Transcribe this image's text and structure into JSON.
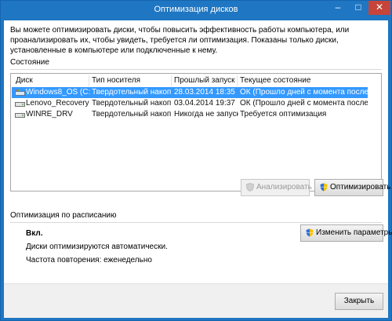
{
  "window": {
    "title": "Оптимизация дисков",
    "controls": {
      "minimize": "–",
      "maximize": "□",
      "close": "✕"
    }
  },
  "intro_text": "Вы можете оптимизировать диски, чтобы повысить эффективность работы  компьютера, или проанализировать их, чтобы увидеть, требуется ли оптимизация. Показаны только диски, установленные в компьютере или подключенные к нему.",
  "status_section": {
    "label": "Состояние",
    "columns": [
      "Диск",
      "Тип носителя",
      "Прошлый запуск",
      "Текущее состояние"
    ],
    "rows": [
      {
        "drive": "Windows8_OS (C:)",
        "media": "Твердотельный накоп...",
        "last_run": "28.03.2014 18:35",
        "status": "ОК (Прошло дней с момента последн...",
        "selected": true,
        "icon": "windows-drive-icon"
      },
      {
        "drive": "Lenovo_Recovery",
        "media": "Твердотельный накоп...",
        "last_run": "03.04.2014 19:37",
        "status": "ОК (Прошло дней с момента последн...",
        "selected": false,
        "icon": "drive-icon"
      },
      {
        "drive": "WINRE_DRV",
        "media": "Твердотельный накоп...",
        "last_run": "Никогда не запуск...",
        "status": "Требуется оптимизация",
        "selected": false,
        "icon": "drive-icon"
      }
    ],
    "analyze_button": "Анализировать",
    "optimize_button": "Оптимизировать"
  },
  "schedule_section": {
    "label": "Оптимизация по расписанию",
    "state": "Вкл.",
    "description": "Диски оптимизируются автоматически.",
    "frequency": "Частота повторения: еженедельно",
    "change_button": "Изменить параметры"
  },
  "close_button": "Закрыть",
  "colors": {
    "titlebar": "#1f76c2",
    "selection": "#3399ff",
    "close_control": "#c7443a"
  }
}
